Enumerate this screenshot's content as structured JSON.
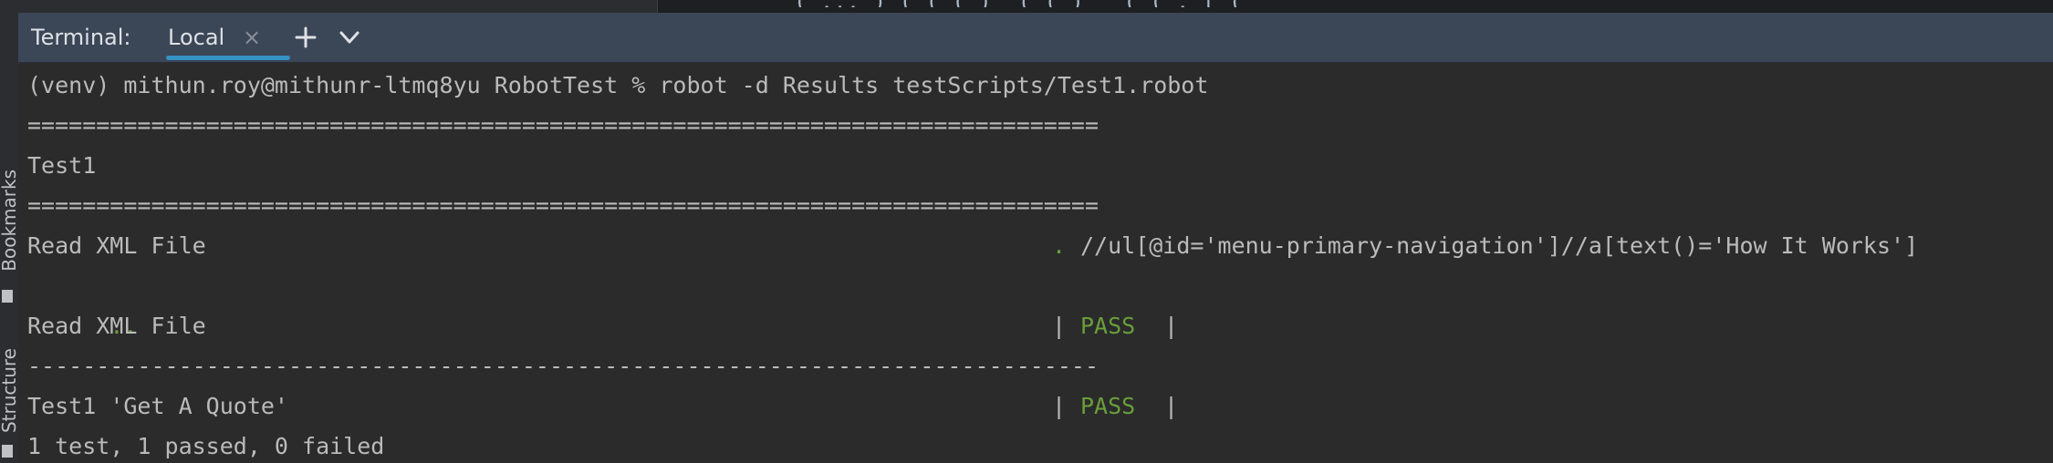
{
  "sidebar": {
    "bookmarks_label": "Bookmarks",
    "structure_label": "Structure"
  },
  "editor": {
    "partial_text": "( ... ) ( ( ( )' ( ( ) ' ( ( . [ ( "
  },
  "terminal": {
    "title": "Terminal:",
    "tab_label": "Local",
    "close_glyph": "×",
    "new_tab_icon": "plus-icon",
    "more_icon": "chevron-down-icon",
    "accent": "#3592c4",
    "pass_color": "#6a9e3b"
  },
  "output": {
    "command": "(venv) mithun.roy@mithunr-ltmq8yu RobotTest % robot -d Results testScripts/Test1.robot",
    "separator_eq": "==============================================================================",
    "suite_name": "Test1",
    "test_name": "Read XML File",
    "log_dot": ".",
    "log_text": "//ul[@id='menu-primary-navigation']//a[text()='How It Works']",
    "continuation_dots": "..",
    "continuation_text": "'Get A Quote'",
    "pipe": "|",
    "status": "PASS",
    "separator_dash": "------------------------------------------------------------------------------",
    "summary": "1 test, 1 passed, 0 failed"
  }
}
